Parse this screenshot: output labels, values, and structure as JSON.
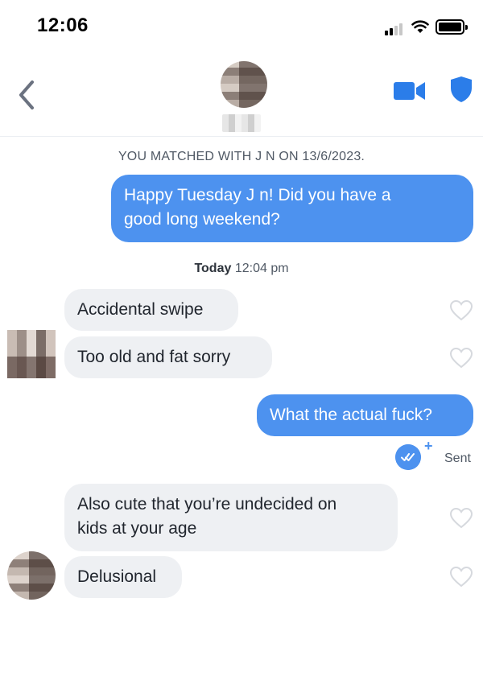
{
  "status_bar": {
    "time": "12:06"
  },
  "header": {
    "match_name": "J",
    "icons": [
      "back-icon",
      "video-call-icon",
      "safety-shield-icon"
    ]
  },
  "chat": {
    "matched_notice": "YOU MATCHED WITH J        N ON 13/6/2023.",
    "time_divider": {
      "day": "Today",
      "time": "12:04 pm"
    },
    "messages": [
      {
        "direction": "outgoing",
        "lines": [
          "Happy Tuesday J      n! Did you have a",
          "good long weekend?"
        ]
      },
      {
        "direction": "incoming",
        "lines": [
          "Accidental swipe"
        ]
      },
      {
        "direction": "incoming",
        "lines": [
          "Too old and fat sorry"
        ]
      },
      {
        "direction": "outgoing",
        "lines": [
          "What the actual fuck?"
        ]
      },
      {
        "direction": "incoming",
        "lines": [
          "Also cute that you’re undecided on",
          "kids at your age"
        ]
      },
      {
        "direction": "incoming",
        "lines": [
          "Delusional"
        ]
      }
    ],
    "receipt": {
      "status": "Sent",
      "plus": "+"
    }
  },
  "colors": {
    "accent": "#4d92ef",
    "incoming_bubble": "#eef0f3",
    "text": "#21262e",
    "muted_text": "#505965"
  }
}
